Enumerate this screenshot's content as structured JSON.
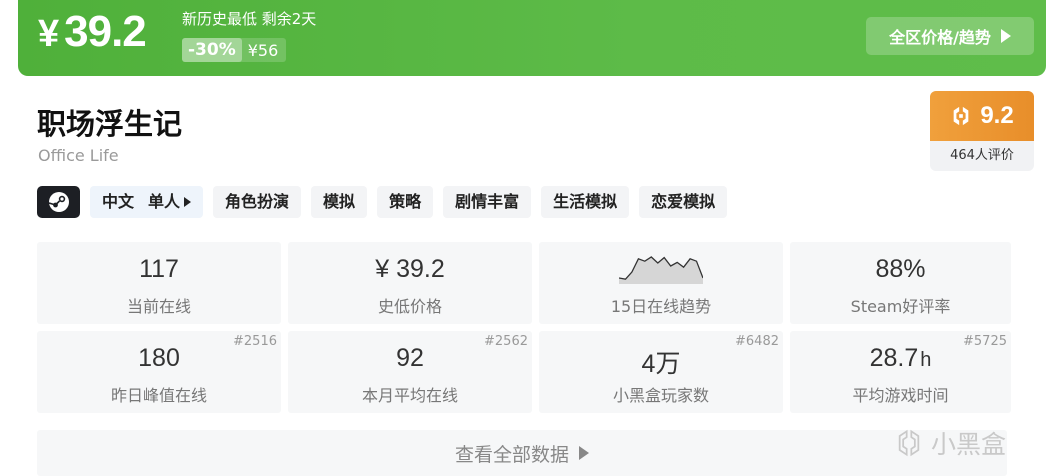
{
  "banner": {
    "currency": "¥",
    "price": "39.2",
    "note": "新历史最低 剩余2天",
    "discount": "-30%",
    "original_price": "¥56",
    "region_button": "全区价格/趋势"
  },
  "game": {
    "title": "职场浮生记",
    "subtitle": "Office Life"
  },
  "rating": {
    "score": "9.2",
    "count": "464人评价"
  },
  "tags": {
    "platform_icon": "steam-icon",
    "language": "中文",
    "players": "单人",
    "items": [
      "角色扮演",
      "模拟",
      "策略",
      "剧情丰富",
      "生活模拟",
      "恋爱模拟"
    ]
  },
  "stats": {
    "current_online": {
      "value": "117",
      "label": "当前在线"
    },
    "lowest_price": {
      "value": "¥ 39.2",
      "label": "史低价格"
    },
    "trend": {
      "label": "15日在线趋势",
      "points": [
        60,
        58,
        70,
        92,
        88,
        95,
        85,
        94,
        80,
        86,
        78,
        92,
        88,
        60
      ]
    },
    "steam_rating": {
      "value": "88%",
      "label": "Steam好评率"
    },
    "yesterday_peak": {
      "value": "180",
      "label": "昨日峰值在线",
      "rank": "#2516"
    },
    "monthly_avg": {
      "value": "92",
      "label": "本月平均在线",
      "rank": "#2562"
    },
    "heybox_players": {
      "value": "4万",
      "label": "小黑盒玩家数",
      "rank": "#6482"
    },
    "avg_playtime": {
      "value": "28.7",
      "unit": "h",
      "label": "平均游戏时间",
      "rank": "#5725"
    }
  },
  "view_all": "查看全部数据",
  "watermark": "小黑盒",
  "colors": {
    "banner_green": "#5dbb48",
    "rating_orange": "#ec952f"
  }
}
